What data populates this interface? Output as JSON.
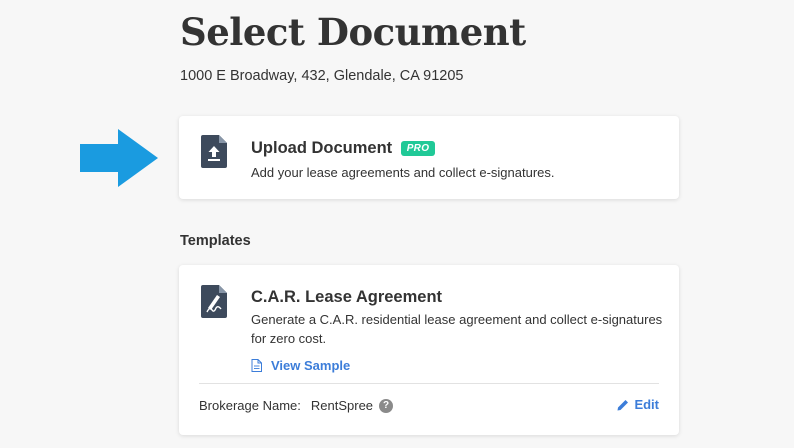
{
  "page": {
    "title": "Select Document",
    "address": "1000 E Broadway, 432, Glendale, CA 91205"
  },
  "upload": {
    "title": "Upload Document",
    "badge": "PRO",
    "description": "Add your lease agreements and collect e-signatures.",
    "icon": "upload-document-icon"
  },
  "templates": {
    "section_label": "Templates",
    "items": [
      {
        "title": "C.A.R. Lease Agreement",
        "description": "Generate a C.A.R. residential lease agreement and collect e-signatures for zero cost.",
        "view_sample_label": "View Sample",
        "brokerage_label": "Brokerage Name:",
        "brokerage_value": "RentSpree",
        "edit_label": "Edit",
        "icon": "signature-document-icon"
      }
    ]
  },
  "colors": {
    "accent_blue": "#3c7dd9",
    "arrow_blue": "#1a9be0",
    "pro_green": "#20c997",
    "icon_dark": "#3d4a5c"
  }
}
